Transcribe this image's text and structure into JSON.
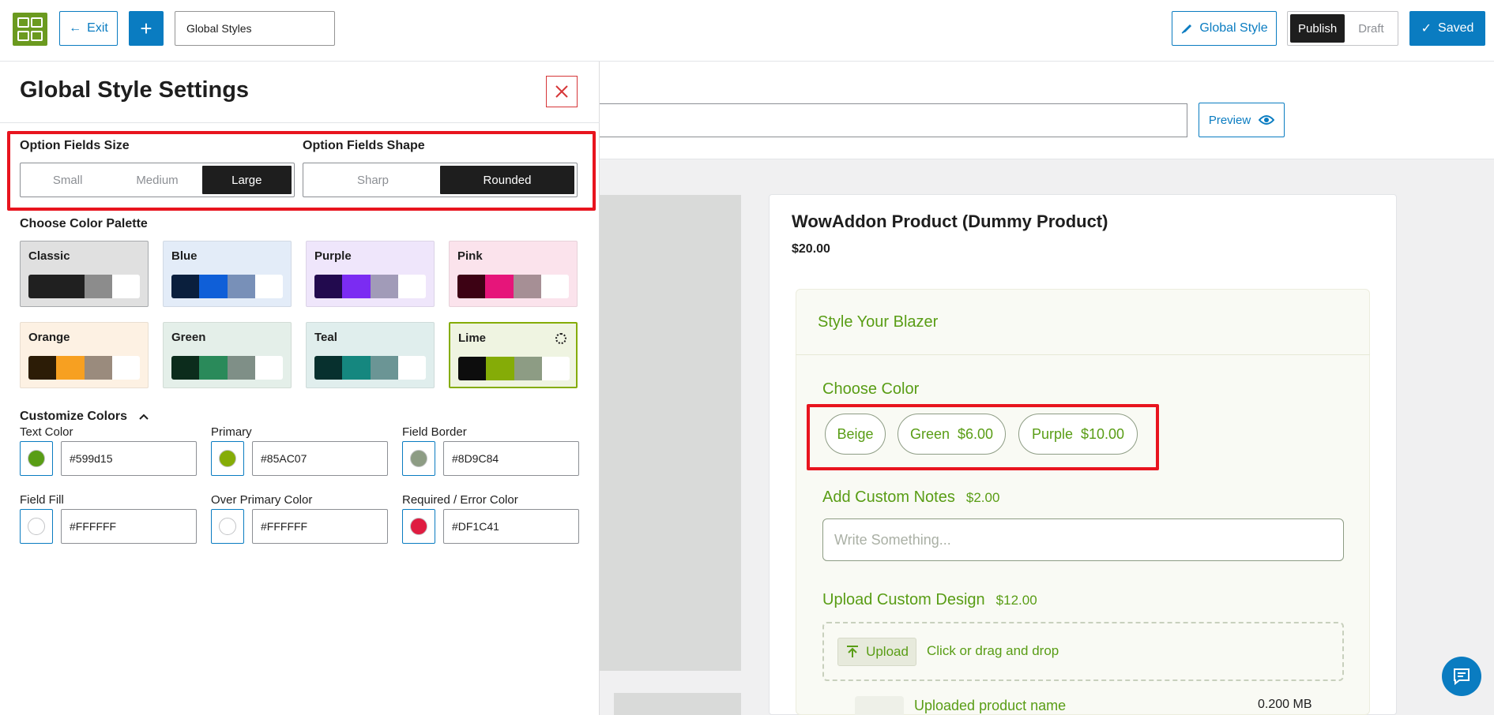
{
  "topbar": {
    "exit_label": "Exit",
    "add_symbol": "+",
    "title_value": "Global Styles",
    "global_style_label": "Global Style",
    "publish_label": "Publish",
    "draft_label": "Draft",
    "saved_label": "Saved"
  },
  "panel": {
    "title": "Global Style Settings",
    "option_size_label": "Option Fields Size",
    "sizes": [
      "Small",
      "Medium",
      "Large"
    ],
    "selected_size": "Large",
    "option_shape_label": "Option Fields Shape",
    "shapes": [
      "Sharp",
      "Rounded"
    ],
    "selected_shape": "Rounded",
    "palette_label": "Choose Color Palette",
    "palettes": [
      {
        "name": "Classic",
        "bg": "#e0e0e0",
        "colors": [
          "#202020",
          "#202020",
          "#8c8c8c",
          "#ffffff"
        ]
      },
      {
        "name": "Blue",
        "bg": "#e3ecf8",
        "colors": [
          "#0a1f3d",
          "#0f5fd8",
          "#7890b8",
          "#ffffff"
        ]
      },
      {
        "name": "Purple",
        "bg": "#efe6fb",
        "colors": [
          "#220a4e",
          "#7b2cf2",
          "#a19bb8",
          "#ffffff"
        ]
      },
      {
        "name": "Pink",
        "bg": "#fbe3ec",
        "colors": [
          "#3d0214",
          "#e6157a",
          "#a68f95",
          "#ffffff"
        ]
      },
      {
        "name": "Orange",
        "bg": "#fdf1e3",
        "colors": [
          "#2c1c06",
          "#f7a021",
          "#9a8b7d",
          "#ffffff"
        ]
      },
      {
        "name": "Green",
        "bg": "#e4efe9",
        "colors": [
          "#0c2c1c",
          "#2a8a5a",
          "#7f8f87",
          "#ffffff"
        ]
      },
      {
        "name": "Teal",
        "bg": "#e0eeed",
        "colors": [
          "#07302e",
          "#15877f",
          "#6b9595",
          "#ffffff"
        ]
      },
      {
        "name": "Lime",
        "bg": "#eff4e1",
        "colors": [
          "#0d0d0d",
          "#85ac07",
          "#8d9c84",
          "#ffffff"
        ],
        "selected": true
      }
    ],
    "customize_label": "Customize Colors",
    "color_fields": [
      {
        "label": "Text Color",
        "value": "#599d15",
        "swatch": "#599d15"
      },
      {
        "label": "Primary",
        "value": "#85AC07",
        "swatch": "#85ac07"
      },
      {
        "label": "Field Border",
        "value": "#8D9C84",
        "swatch": "#8d9c84"
      },
      {
        "label": "Field Fill",
        "value": "#FFFFFF",
        "swatch": "#ffffff"
      },
      {
        "label": "Over Primary Color",
        "value": "#FFFFFF",
        "swatch": "#ffffff"
      },
      {
        "label": "Required / Error Color",
        "value": "#DF1C41",
        "swatch": "#df1c41"
      }
    ]
  },
  "preview": {
    "preview_label": "Preview",
    "product_name": "WowAddon Product (Dummy Product)",
    "product_price": "$20.00",
    "block_title": "Style Your Blazer",
    "choose_color_label": "Choose Color",
    "color_options": [
      {
        "label": "Beige",
        "price": ""
      },
      {
        "label": "Green",
        "price": "$6.00"
      },
      {
        "label": "Purple",
        "price": "$10.00"
      }
    ],
    "notes_label": "Add Custom Notes",
    "notes_price": "$2.00",
    "notes_placeholder": "Write Something...",
    "upload_label": "Upload Custom Design",
    "upload_price": "$12.00",
    "upload_button": "Upload",
    "upload_hint": "Click or drag and drop",
    "uploaded_name": "Uploaded product name",
    "uploaded_size": "0.200 MB"
  },
  "colors": {
    "accent": "#0a7cc1",
    "text_green": "#599d15",
    "highlight": "#e8141e"
  }
}
